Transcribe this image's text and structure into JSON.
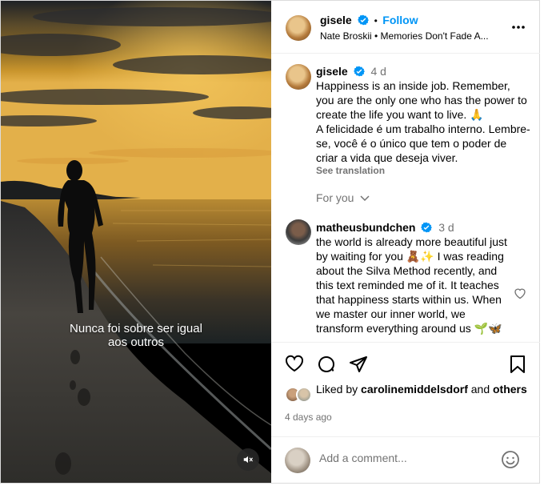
{
  "media": {
    "overlay_line1": "Nunca foi sobre ser igual",
    "overlay_line2": "aos outros",
    "mute_icon": "speaker-muted-icon"
  },
  "header": {
    "username": "gisele",
    "separator": "•",
    "follow_label": "Follow",
    "audio": "Nate Broskii • Memories Don't Fade A...",
    "more_icon": "more-options-icon"
  },
  "caption": {
    "username": "gisele",
    "time": "4 d",
    "text_en": "Happiness is an inside job. Remember, you are the only one who has the power to create the life you want to live. 🙏",
    "text_pt": "A felicidade é um trabalho interno. Lembre-se, você é o único que tem o poder de criar a vida que deseja viver.",
    "see_translation": "See translation"
  },
  "for_you": "For you",
  "comment": {
    "username": "matheusbundchen",
    "time": "3 d",
    "text": "the world is already more beautiful just by waiting for you 🧸✨ I was reading about the Silva Method recently, and this text reminded me of it. It teaches that happiness starts within us. When we master our inner world, we transform everything around us 🌱🦋"
  },
  "likes": {
    "prefix": "Liked by",
    "user": "carolinemiddelsdorf",
    "and": "and",
    "others": "others"
  },
  "posted": "4 days ago",
  "add_comment": {
    "placeholder": "Add a comment..."
  },
  "colors": {
    "link_blue": "#0095f6",
    "muted": "#737373",
    "verified": "#0095f6"
  }
}
